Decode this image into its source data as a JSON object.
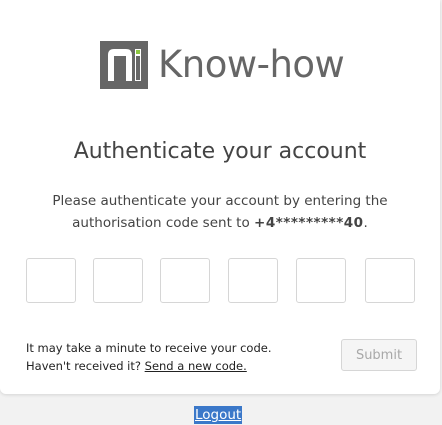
{
  "brand": {
    "name": "Know-how",
    "logo_icon": "know-how-logo-icon",
    "colors": {
      "logo_grey": "#666666",
      "logo_green": "#8cc640"
    }
  },
  "heading": "Authenticate your account",
  "instructions": {
    "text": "Please authenticate your account by entering the authorisation code sent to",
    "phone": "+4*********40",
    "suffix": "."
  },
  "code_inputs": {
    "count": 6,
    "values": [
      "",
      "",
      "",
      "",
      "",
      ""
    ]
  },
  "help": {
    "line1": "It may take a minute to receive your code.",
    "line2_prefix": "Haven't received it?",
    "resend_link": "Send a new code."
  },
  "submit_label": "Submit",
  "logout_label": "Logout",
  "colors": {
    "selection_blue": "#3b78c9",
    "disabled_text": "#a8a8a8"
  }
}
